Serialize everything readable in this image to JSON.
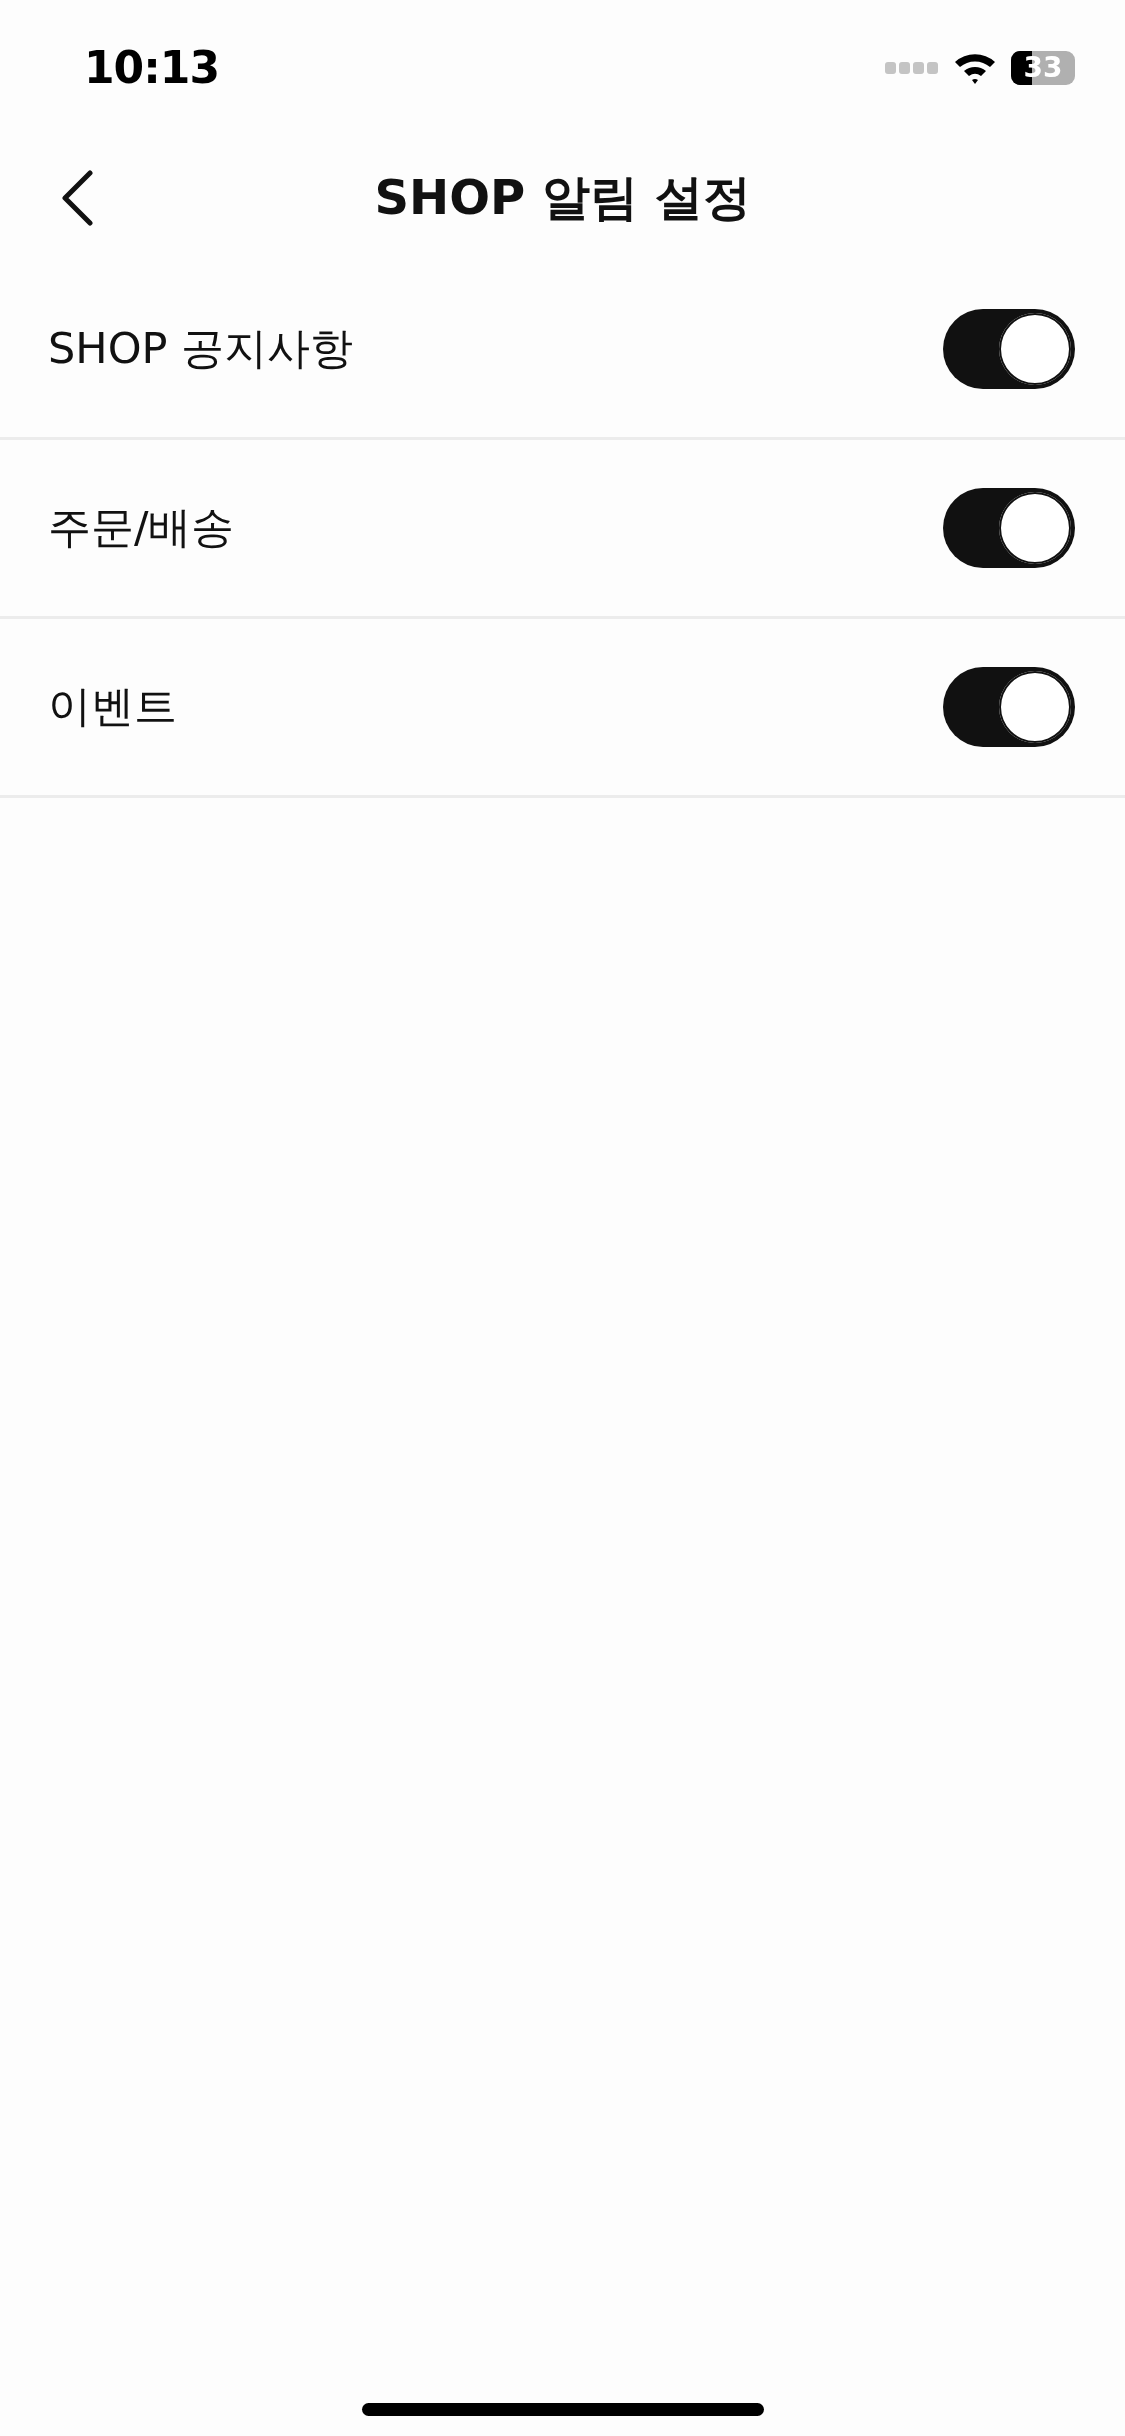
{
  "status_bar": {
    "time": "10:13",
    "battery": "33"
  },
  "nav": {
    "title": "SHOP 알림 설정"
  },
  "settings": [
    {
      "label": "SHOP 공지사항",
      "on": true
    },
    {
      "label": "주문/배송",
      "on": true
    },
    {
      "label": "이벤트",
      "on": true
    }
  ]
}
